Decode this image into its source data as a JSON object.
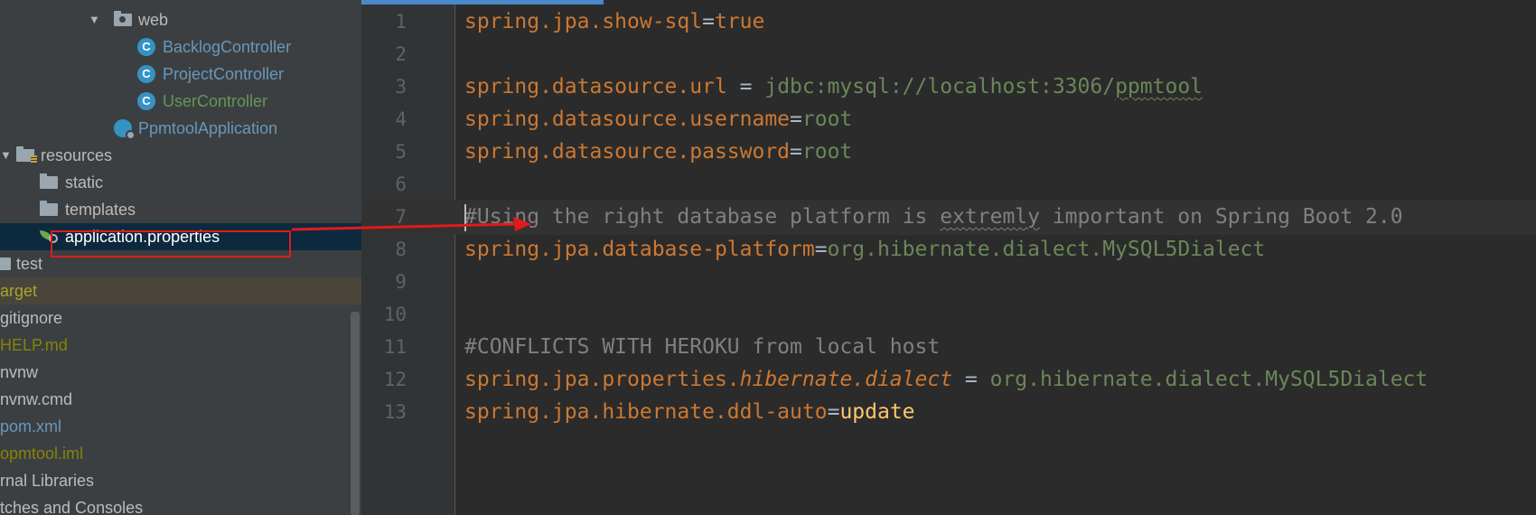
{
  "project_tree": {
    "items": [
      {
        "label": "web",
        "type": "package",
        "expanded": true
      },
      {
        "label": "BacklogController",
        "type": "class"
      },
      {
        "label": "ProjectController",
        "type": "class"
      },
      {
        "label": "UserController",
        "type": "class",
        "color": "#629755"
      },
      {
        "label": "PpmtoolApplication",
        "type": "app-class"
      },
      {
        "label": "resources",
        "type": "resources-folder",
        "expanded": true
      },
      {
        "label": "static",
        "type": "folder"
      },
      {
        "label": "templates",
        "type": "folder"
      },
      {
        "label": "application.properties",
        "type": "properties-file",
        "selected": true
      },
      {
        "label": "test",
        "type": "folder"
      },
      {
        "label": "arget",
        "type": "excluded-folder"
      },
      {
        "label": "gitignore",
        "type": "file"
      },
      {
        "label": "HELP.md",
        "type": "file"
      },
      {
        "label": "nvnw",
        "type": "file"
      },
      {
        "label": "nvnw.cmd",
        "type": "file"
      },
      {
        "label": "pom.xml",
        "type": "file"
      },
      {
        "label": "opmtool.iml",
        "type": "file"
      },
      {
        "label": "rnal Libraries",
        "type": "libraries"
      },
      {
        "label": "tches and Consoles",
        "type": "scratches"
      }
    ],
    "colors": {
      "default": "#bbbbbb",
      "class": "#6897bb",
      "vcs_added": "#629755",
      "ignored": "#848504",
      "excluded": "#a5a431"
    }
  },
  "editor": {
    "file_name": "application.properties",
    "current_line": 7,
    "lines": [
      {
        "n": "1",
        "parts": [
          {
            "t": "spring.jpa.show-sql",
            "s": "k"
          },
          {
            "t": "=",
            "s": "op"
          },
          {
            "t": "true",
            "s": "k"
          }
        ]
      },
      {
        "n": "2",
        "parts": []
      },
      {
        "n": "3",
        "parts": [
          {
            "t": "spring.datasource.url",
            "s": "k"
          },
          {
            "t": " = ",
            "s": "op"
          },
          {
            "t": "jdbc:mysql://localhost:3306/",
            "s": "v"
          },
          {
            "t": "ppmtool",
            "s": "v sq"
          }
        ]
      },
      {
        "n": "4",
        "parts": [
          {
            "t": "spring.datasource.username",
            "s": "k"
          },
          {
            "t": "=",
            "s": "op"
          },
          {
            "t": "root",
            "s": "v"
          }
        ]
      },
      {
        "n": "5",
        "parts": [
          {
            "t": "spring.datasource.password",
            "s": "k"
          },
          {
            "t": "=",
            "s": "op"
          },
          {
            "t": "root",
            "s": "v"
          }
        ]
      },
      {
        "n": "6",
        "parts": []
      },
      {
        "n": "7",
        "parts": [
          {
            "t": "#Using the right database platform is ",
            "s": "c"
          },
          {
            "t": "extremly",
            "s": "c sqc"
          },
          {
            "t": " important on Spring Boot 2.0",
            "s": "c"
          }
        ]
      },
      {
        "n": "8",
        "parts": [
          {
            "t": "spring.jpa.database-platform",
            "s": "k"
          },
          {
            "t": "=",
            "s": "op"
          },
          {
            "t": "org.hibernate.dialect.MySQL5Dialect",
            "s": "v"
          }
        ]
      },
      {
        "n": "9",
        "parts": []
      },
      {
        "n": "10",
        "parts": []
      },
      {
        "n": "11",
        "parts": [
          {
            "t": "#CONFLICTS WITH HEROKU from local host",
            "s": "c"
          }
        ]
      },
      {
        "n": "12",
        "parts": [
          {
            "t": "spring.jpa.properties.",
            "s": "k"
          },
          {
            "t": "hibernate.dialect",
            "s": "k it"
          },
          {
            "t": " = ",
            "s": "op"
          },
          {
            "t": "org.hibernate.dialect.MySQL5Dialect",
            "s": "v"
          }
        ]
      },
      {
        "n": "13",
        "parts": [
          {
            "t": "spring.jpa.hibernate.ddl-auto",
            "s": "k"
          },
          {
            "t": "=",
            "s": "op"
          },
          {
            "t": "update",
            "s": "kw"
          }
        ]
      }
    ]
  },
  "annotation": {
    "color": "#e21a1a"
  }
}
